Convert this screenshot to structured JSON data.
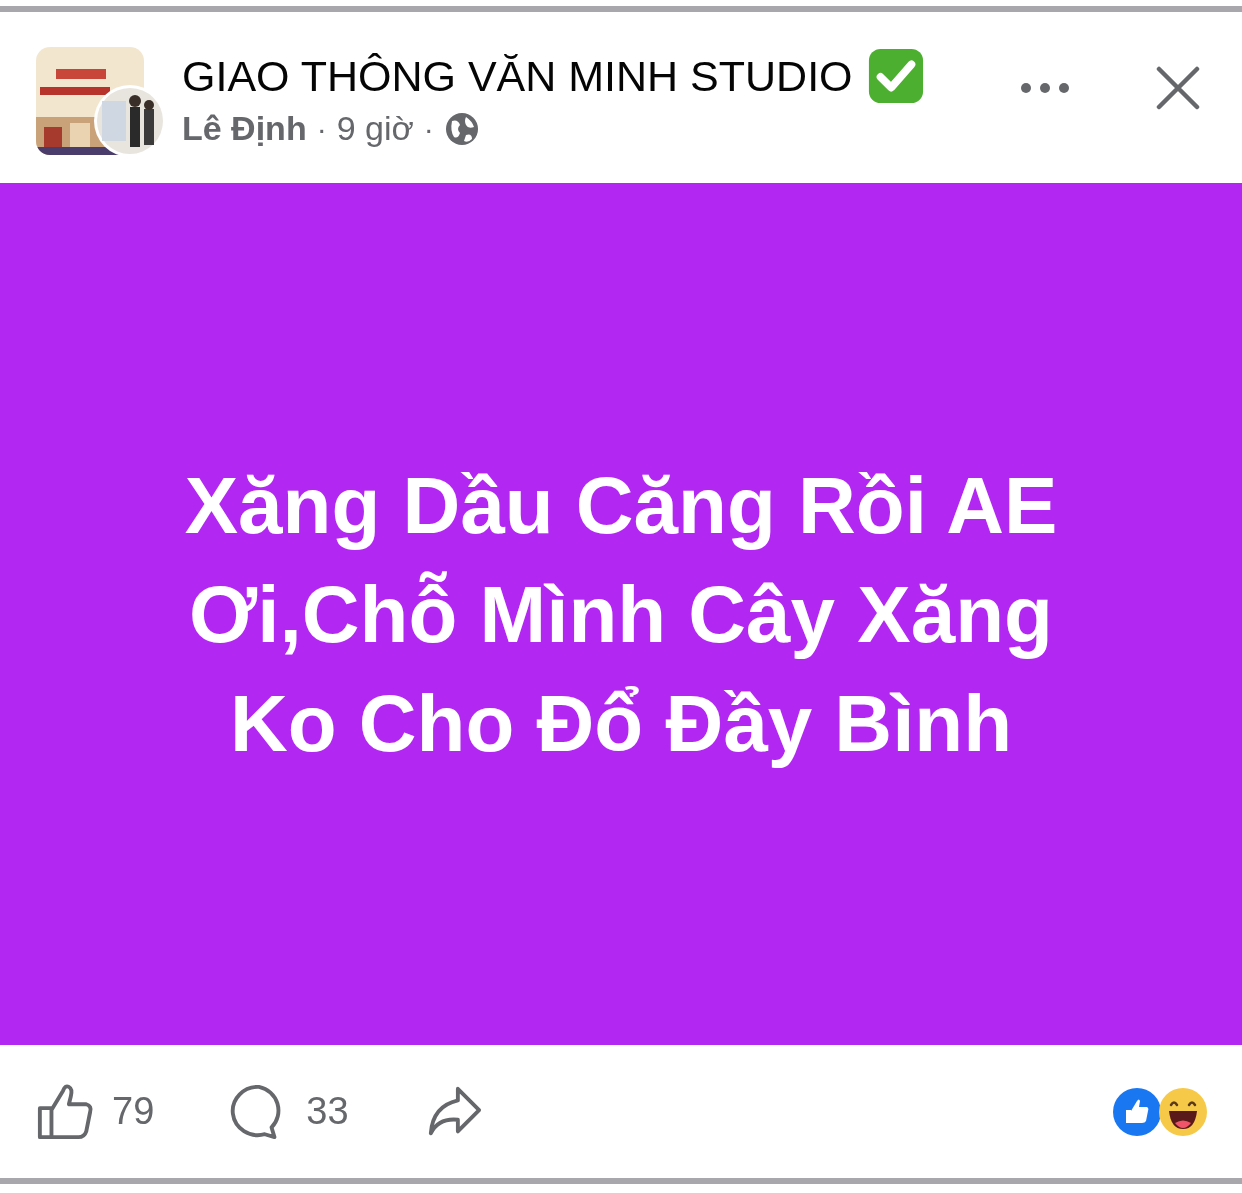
{
  "post": {
    "group_name": "GIAO THÔNG VĂN MINH STUDIO",
    "verified": true,
    "author": "Lê Định",
    "separator": "·",
    "time": "9 giờ",
    "public": true
  },
  "content": {
    "text": "Xăng Dầu Căng Rồi AE Ơi,Chỗ Mình Cây Xăng Ko Cho Đổ Đầy Bình"
  },
  "footer": {
    "likes": "79",
    "comments": "33",
    "reactions": [
      {
        "kind": "like"
      },
      {
        "kind": "haha"
      }
    ]
  }
}
